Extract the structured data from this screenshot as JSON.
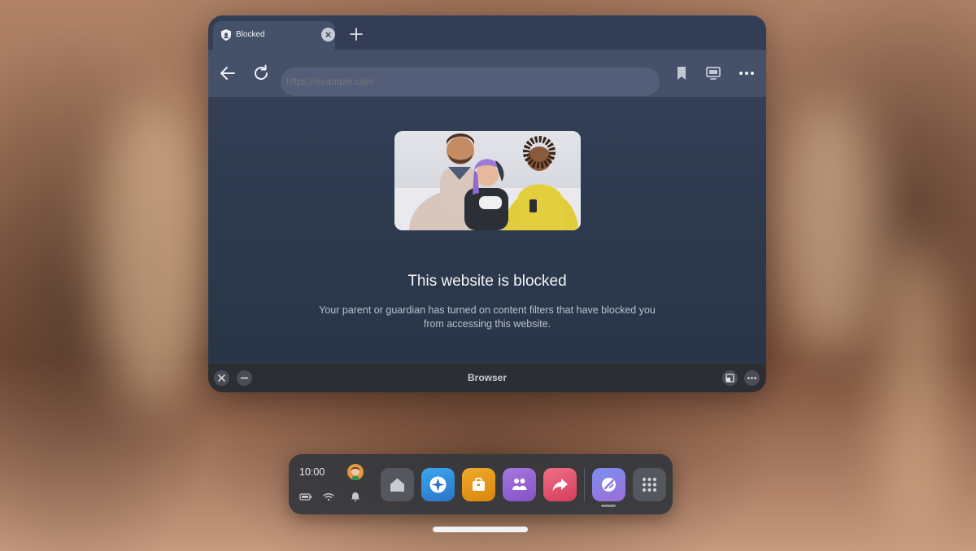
{
  "tab": {
    "label": "Blocked",
    "close_glyph": "×",
    "icon": "shield-icon"
  },
  "new_tab_icon": "plus-icon",
  "nav": {
    "back_icon": "back-arrow-icon",
    "reload_icon": "reload-icon",
    "url_placeholder": "https://example.com",
    "bookmark_icon": "bookmark-icon",
    "display_icon": "monitor-icon",
    "more_icon": "more-icon"
  },
  "page": {
    "headline": "This website is blocked",
    "description": "Your parent or guardian has turned on content filters that have blocked you from accessing this website."
  },
  "footer": {
    "title": "Browser",
    "close_icon": "close-icon",
    "minimize_icon": "minimize-icon",
    "resize_icon": "resize-icon",
    "more_icon": "more-icon"
  },
  "dock": {
    "time": "10:00",
    "status_icons": [
      "battery-icon",
      "wifi-icon",
      "bell-icon"
    ],
    "apps": [
      {
        "name": "home",
        "icon": "home-icon",
        "color": "#5a5c63"
      },
      {
        "name": "explore",
        "icon": "compass-icon",
        "color": "#2f8fd8"
      },
      {
        "name": "store",
        "icon": "bag-icon",
        "color": "#e39a1c"
      },
      {
        "name": "people",
        "icon": "people-icon",
        "color": "#9b63d4"
      },
      {
        "name": "share",
        "icon": "share-icon",
        "color": "#e0516f"
      },
      {
        "name": "browser",
        "icon": "browser-icon",
        "color": "#8c7ae6"
      },
      {
        "name": "library",
        "icon": "grid-icon",
        "color": "#5a5c63"
      }
    ]
  }
}
